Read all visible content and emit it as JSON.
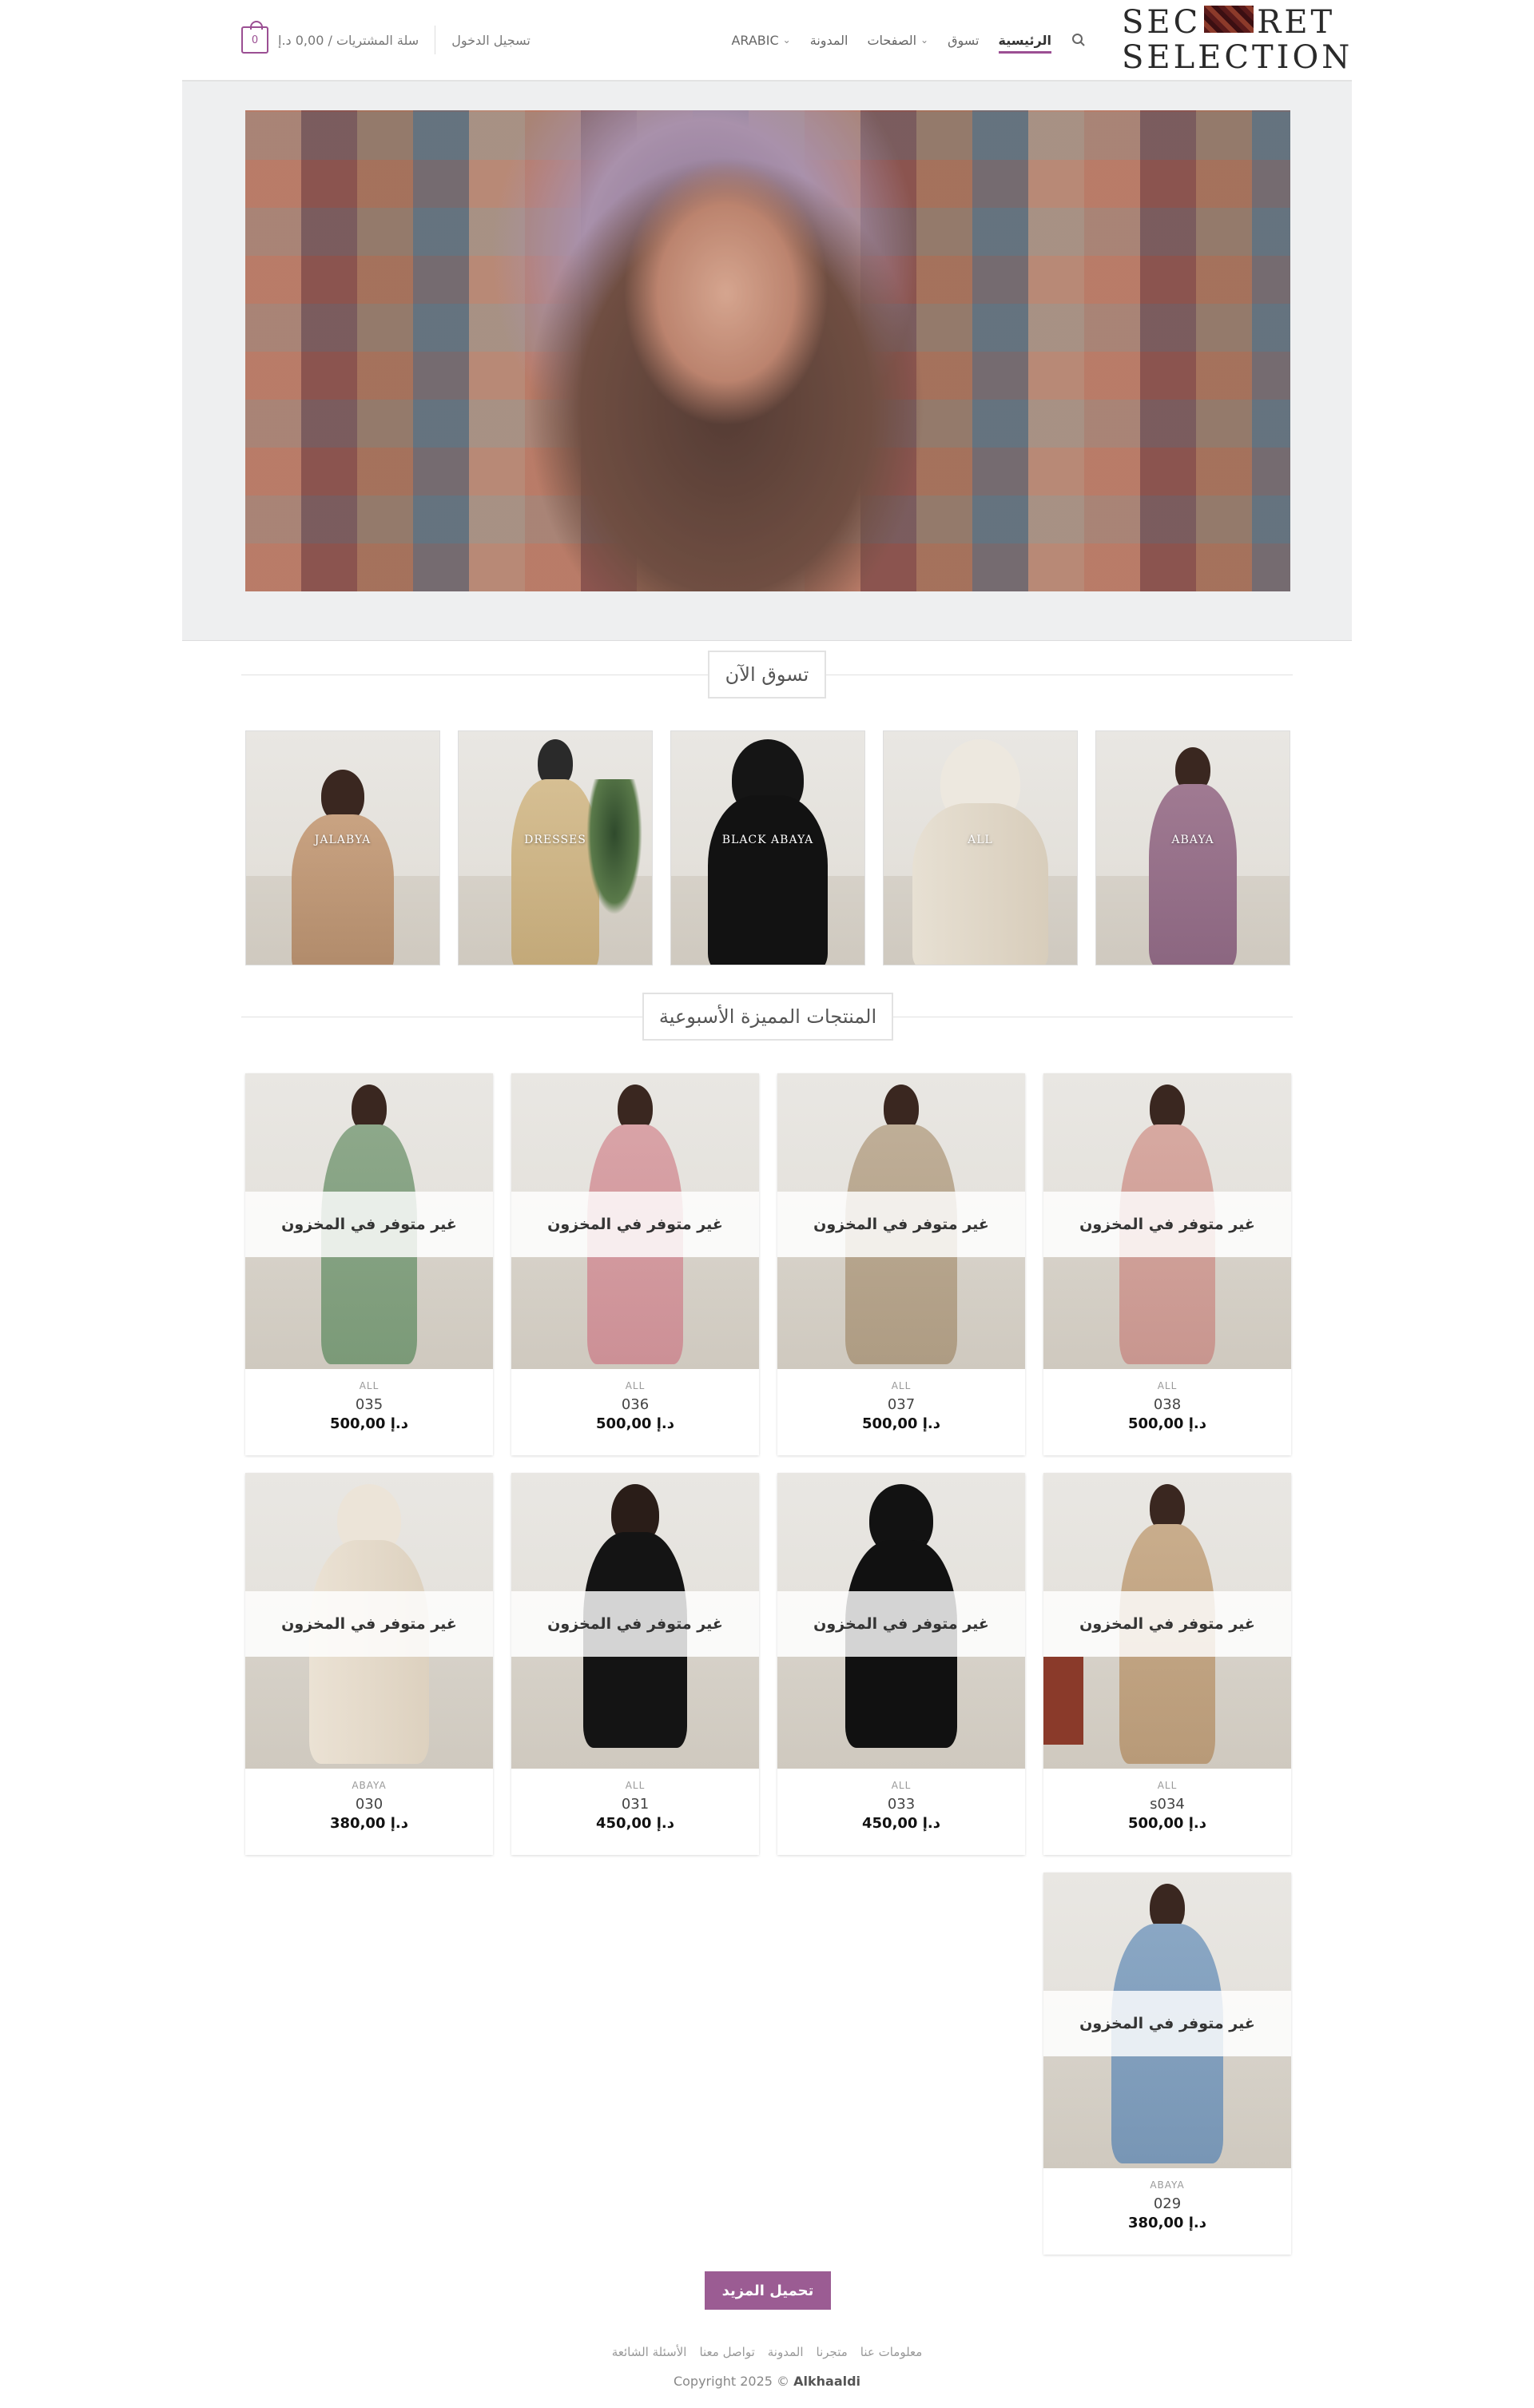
{
  "header": {
    "logo_line1": "SEC",
    "logo_line1b": "RET",
    "logo_line2": "SELECTION",
    "nav": [
      {
        "label": "الرئيسية",
        "active": true
      },
      {
        "label": "تسوق"
      },
      {
        "label": "الصفحات",
        "dropdown": true
      },
      {
        "label": "المدونة"
      },
      {
        "label": "ARABIC",
        "dropdown": true
      }
    ],
    "login": "تسجيل الدخول",
    "cart_label": "سلة المشتريات / 0,00 د.إ",
    "cart_count": "0"
  },
  "sections": {
    "shop_now": "تسوق الآن",
    "featured": "المنتجات المميزة الأسبوعية"
  },
  "categories": [
    "JALABYA",
    "DRESSES",
    "BLACK ABAYA",
    "ALL",
    "ABAYA"
  ],
  "products": [
    {
      "status": "غير متوفر في المخزون",
      "category": "ALL",
      "name": "035",
      "price": "500,00 د.إ"
    },
    {
      "status": "غير متوفر في المخزون",
      "category": "ALL",
      "name": "036",
      "price": "500,00 د.إ"
    },
    {
      "status": "غير متوفر في المخزون",
      "category": "ALL",
      "name": "037",
      "price": "500,00 د.إ"
    },
    {
      "status": "غير متوفر في المخزون",
      "category": "ALL",
      "name": "038",
      "price": "500,00 د.إ"
    },
    {
      "status": "غير متوفر في المخزون",
      "category": "ABAYA",
      "name": "030",
      "price": "380,00 د.إ"
    },
    {
      "status": "غير متوفر في المخزون",
      "category": "ALL",
      "name": "031",
      "price": "450,00 د.إ"
    },
    {
      "status": "غير متوفر في المخزون",
      "category": "ALL",
      "name": "033",
      "price": "450,00 د.إ"
    },
    {
      "status": "غير متوفر في المخزون",
      "category": "ALL",
      "name": "s034",
      "price": "500,00 د.إ"
    },
    {
      "status": "غير متوفر في المخزون",
      "category": "ABAYA",
      "name": "029",
      "price": "380,00 د.إ"
    }
  ],
  "load_more": "تحميل المزيد",
  "footer": {
    "links": [
      "معلومات عنا",
      "متجرنا",
      "المدونة",
      "تواصل معنا",
      "الأسئلة الشائعة"
    ],
    "copyright_prefix": "Copyright 2025 ©",
    "copyright_brand": "Alkhaaldi"
  },
  "colors": {
    "accent": "#9b5c93",
    "nav_underline": "#9b4f93"
  }
}
